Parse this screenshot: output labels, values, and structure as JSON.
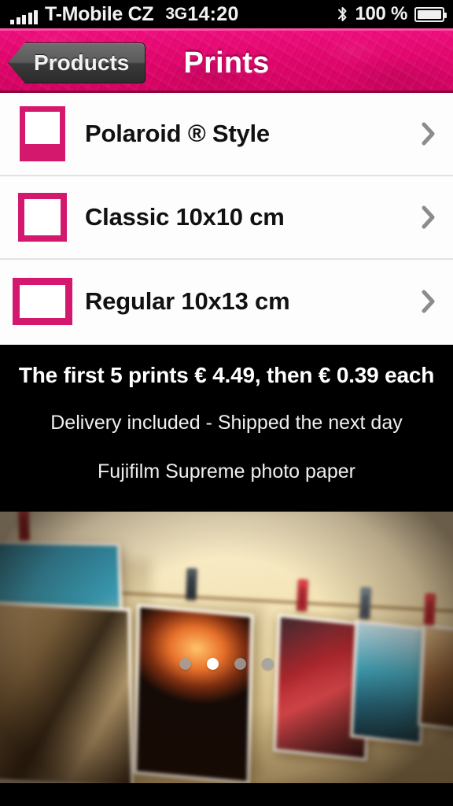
{
  "status_bar": {
    "signal_icon": "signal-bars-icon",
    "carrier": "T-Mobile CZ",
    "network": "3G",
    "time": "14:20",
    "bluetooth_icon": "bluetooth-icon",
    "battery_percent": "100 %",
    "battery_icon": "battery-full-icon"
  },
  "nav_bar": {
    "back_label": "Products",
    "title": "Prints",
    "accent_color": "#e3076e",
    "back_button_color": "#4a4a4a"
  },
  "list": {
    "items": [
      {
        "icon": "polaroid-frame-icon",
        "label": "Polaroid ® Style",
        "chevron": "chevron-right-icon"
      },
      {
        "icon": "square-frame-icon",
        "label": "Classic 10x10 cm",
        "chevron": "chevron-right-icon"
      },
      {
        "icon": "wide-frame-icon",
        "label": "Regular 10x13 cm",
        "chevron": "chevron-right-icon"
      }
    ],
    "frame_color": "#d4186e",
    "chevron_color": "#8c8c8c"
  },
  "info_panel": {
    "headline": "The first 5 prints € 4.49, then € 0.39 each",
    "line2": "Delivery included - Shipped the next day",
    "line3": "Fujifilm Supreme photo paper",
    "background_color": "#000000"
  },
  "carousel": {
    "image_description": "Photo prints hanging on a clothesline with clothespins against a cream wall",
    "page_count": 4,
    "active_page": 2,
    "dots": [
      "inactive",
      "active",
      "inactive",
      "inactive"
    ]
  }
}
